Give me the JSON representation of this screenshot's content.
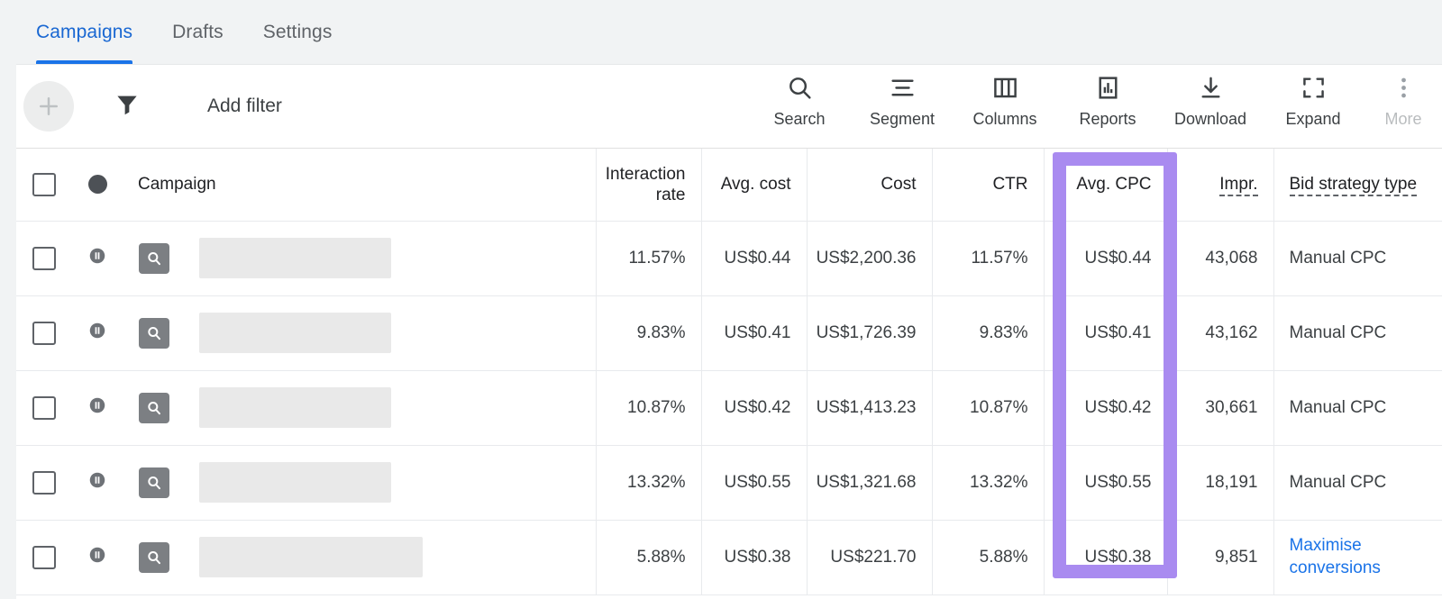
{
  "tabs": [
    {
      "label": "Campaigns",
      "active": true
    },
    {
      "label": "Drafts",
      "active": false
    },
    {
      "label": "Settings",
      "active": false
    }
  ],
  "toolbar": {
    "add_button_icon": "plus-icon",
    "filter_icon": "filter-funnel-icon",
    "add_filter_label": "Add filter",
    "actions": [
      {
        "label": "Search",
        "icon": "search-icon"
      },
      {
        "label": "Segment",
        "icon": "segment-icon"
      },
      {
        "label": "Columns",
        "icon": "columns-icon"
      },
      {
        "label": "Reports",
        "icon": "reports-bar-chart-icon"
      },
      {
        "label": "Download",
        "icon": "download-icon"
      },
      {
        "label": "Expand",
        "icon": "expand-icon"
      },
      {
        "label": "More",
        "icon": "more-vertical-dots-icon"
      }
    ]
  },
  "table": {
    "headers": {
      "campaign": "Campaign",
      "interaction_rate": "Interaction rate",
      "avg_cost": "Avg. cost",
      "cost": "Cost",
      "ctr": "CTR",
      "avg_cpc": "Avg. CPC",
      "impr": "Impr.",
      "bid_strategy_type": "Bid strategy type"
    },
    "rows": [
      {
        "interaction_rate": "11.57%",
        "avg_cost": "US$0.44",
        "cost": "US$2,200.36",
        "ctr": "11.57%",
        "avg_cpc": "US$0.44",
        "impr": "43,068",
        "bid_strategy_type": "Manual CPC",
        "bid_is_link": false,
        "name_redacted_width": 213
      },
      {
        "interaction_rate": "9.83%",
        "avg_cost": "US$0.41",
        "cost": "US$1,726.39",
        "ctr": "9.83%",
        "avg_cpc": "US$0.41",
        "impr": "43,162",
        "bid_strategy_type": "Manual CPC",
        "bid_is_link": false,
        "name_redacted_width": 213
      },
      {
        "interaction_rate": "10.87%",
        "avg_cost": "US$0.42",
        "cost": "US$1,413.23",
        "ctr": "10.87%",
        "avg_cpc": "US$0.42",
        "impr": "30,661",
        "bid_strategy_type": "Manual CPC",
        "bid_is_link": false,
        "name_redacted_width": 213
      },
      {
        "interaction_rate": "13.32%",
        "avg_cost": "US$0.55",
        "cost": "US$1,321.68",
        "ctr": "13.32%",
        "avg_cpc": "US$0.55",
        "impr": "18,191",
        "bid_strategy_type": "Manual CPC",
        "bid_is_link": false,
        "name_redacted_width": 213
      },
      {
        "interaction_rate": "5.88%",
        "avg_cost": "US$0.38",
        "cost": "US$221.70",
        "ctr": "5.88%",
        "avg_cpc": "US$0.38",
        "impr": "9,851",
        "bid_strategy_type": "Maximise conversions",
        "bid_is_link": true,
        "name_redacted_width": 248
      }
    ]
  },
  "annotation": {
    "highlight_color": "#a98bf0",
    "highlighted_column": "Avg. CPC"
  },
  "colors": {
    "accent_blue": "#1a73e8",
    "tab_active": "#1967d2",
    "text_primary": "#202124",
    "text_secondary": "#3c4043",
    "page_bg": "#f1f3f4"
  }
}
